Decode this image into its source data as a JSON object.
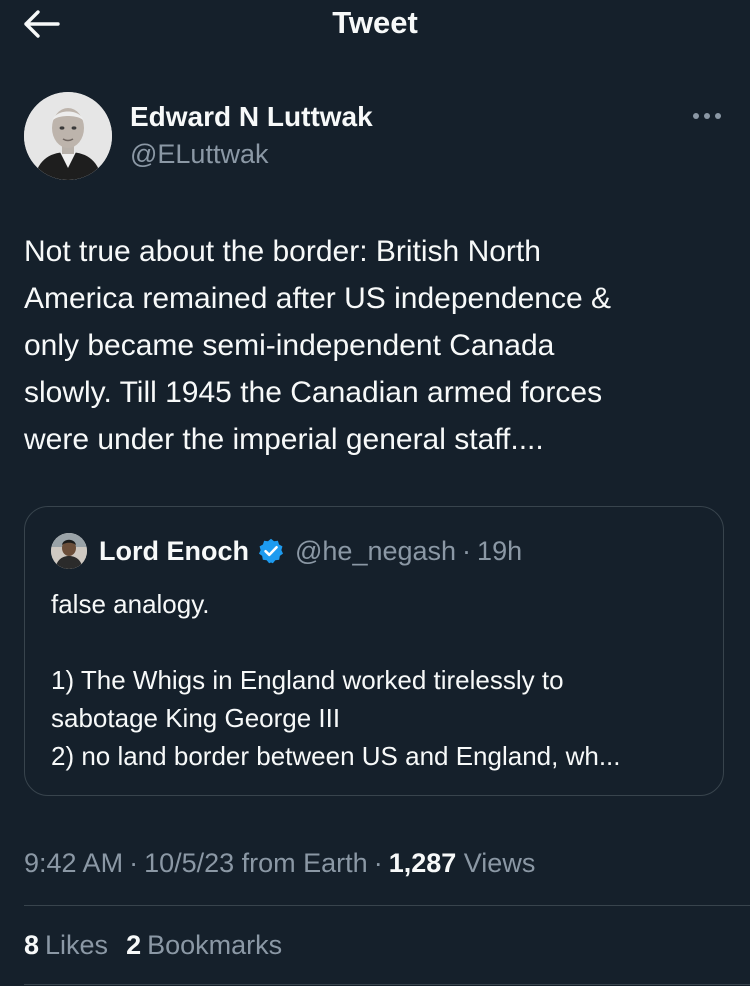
{
  "header": {
    "title": "Tweet",
    "back_icon": "arrow-left-icon"
  },
  "tweet": {
    "author": {
      "name": "Edward N Luttwak",
      "handle": "@ELuttwak"
    },
    "more_icon": "more-horizontal-icon",
    "text": "Not true about the border: British North\nAmerica remained after US independence &\nonly became semi-independent Canada\nslowly. Till 1945 the Canadian armed forces\nwere under the imperial general staff....",
    "quote": {
      "author_name": "Lord Enoch",
      "verified_icon": "verified-badge-icon",
      "handle": "@he_negash",
      "separator": "·",
      "time": "19h",
      "lines": [
        "false analogy.",
        "",
        "1) The Whigs in England worked tirelessly to",
        "sabotage King George III",
        "2) no land border between US and England, wh..."
      ]
    },
    "meta": {
      "time": "9:42 AM",
      "separator": "·",
      "date": "10/5/23 from Earth",
      "views_count": "1,287",
      "views_label": "Views"
    },
    "stats": {
      "likes_count": "8",
      "likes_label": "Likes",
      "bookmarks_count": "2",
      "bookmarks_label": "Bookmarks"
    }
  },
  "colors": {
    "background": "#15202b",
    "text_primary": "#f7f9f9",
    "text_secondary": "#8b98a5",
    "border": "#38444d",
    "verified": "#1d9bf0"
  }
}
